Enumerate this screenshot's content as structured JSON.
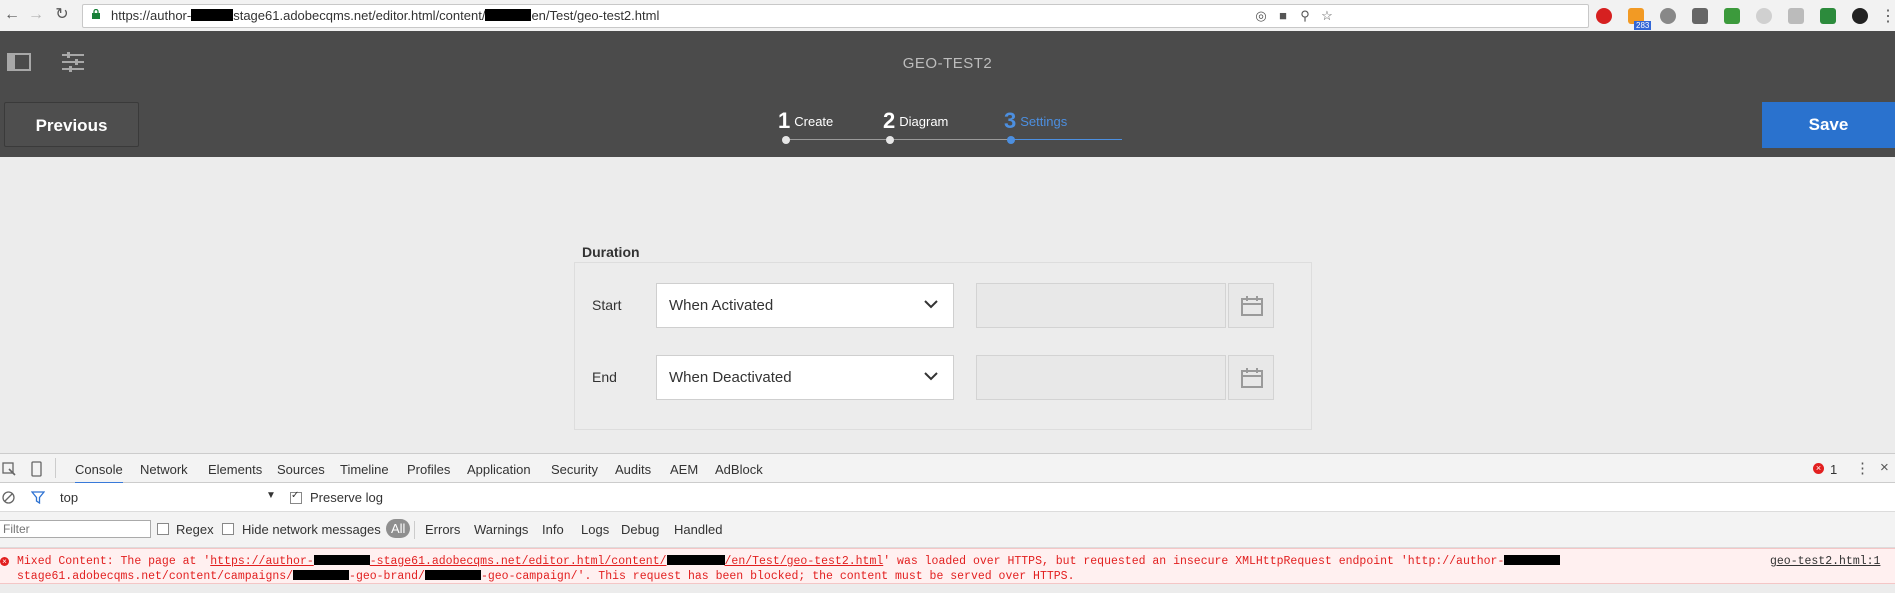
{
  "browser": {
    "url_parts": [
      "https://author-",
      "stage61.adobecqms.net/editor.html/content/",
      "en/Test/geo-test2.html"
    ],
    "extension_badge": "283"
  },
  "aem": {
    "title": "GEO-TEST2",
    "previous_label": "Previous",
    "save_label": "Save",
    "steps": [
      {
        "num": "1",
        "label": "Create"
      },
      {
        "num": "2",
        "label": "Diagram"
      },
      {
        "num": "3",
        "label": "Settings",
        "active": true
      }
    ]
  },
  "form": {
    "section_title": "Duration",
    "start_label": "Start",
    "start_value": "When Activated",
    "end_label": "End",
    "end_value": "When Deactivated"
  },
  "devtools": {
    "tabs": [
      "Console",
      "Network",
      "Elements",
      "Sources",
      "Timeline",
      "Profiles",
      "Application",
      "Security",
      "Audits",
      "AEM",
      "AdBlock"
    ],
    "error_count": "1",
    "context": "top",
    "preserve_log": "Preserve log",
    "filter_placeholder": "Filter",
    "regex": "Regex",
    "hide_network": "Hide network messages",
    "levels": [
      "All",
      "Errors",
      "Warnings",
      "Info",
      "Logs",
      "Debug",
      "Handled"
    ],
    "error": {
      "part1": "Mixed Content: The page at '",
      "link1a": "https://author-",
      "link1b": "-stage61.adobecqms.net/editor.html/content/",
      "link1c": "/en/Test/geo-test2.html",
      "part2": "' was loaded over HTTPS, but requested an insecure XMLHttpRequest endpoint 'http://author-",
      "line2a": "stage61.adobecqms.net/content/campaigns/",
      "line2b": "-geo-brand/",
      "line2c": "-geo-campaign/'. This request has been blocked; the content must be served over HTTPS.",
      "source": "geo-test2.html:1"
    }
  }
}
